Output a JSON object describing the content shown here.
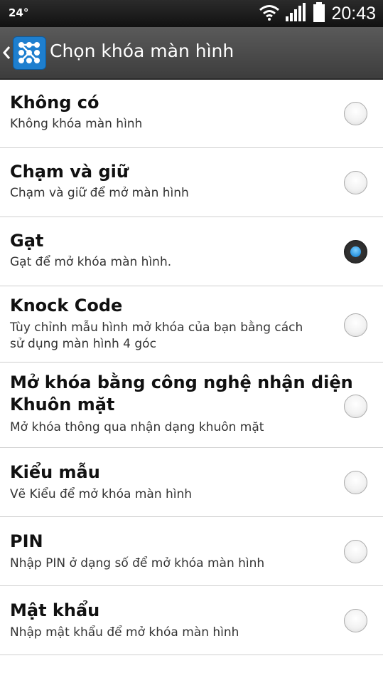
{
  "status_bar": {
    "temperature": "24°",
    "time": "20:43"
  },
  "header": {
    "back_icon": "chevron-left-icon",
    "app_icon": "pattern-lock-icon",
    "title": "Chọn khóa màn hình"
  },
  "colors": {
    "accent": "#2b95e0",
    "header_bg": "#484848",
    "status_bg": "#1a1a1a"
  },
  "options": [
    {
      "title": "Không có",
      "subtitle": "Không khóa màn hình",
      "selected": false
    },
    {
      "title": "Chạm và giữ",
      "subtitle": "Chạm và giữ để mở màn hình",
      "selected": false
    },
    {
      "title": "Gạt",
      "subtitle": "Gạt để mở khóa màn hình.",
      "selected": true
    },
    {
      "title": "Knock Code",
      "subtitle_lines": [
        "Tùy chỉnh mẫu hình mở khóa của bạn bằng cách",
        "sử dụng màn hình 4 góc"
      ],
      "selected": false
    },
    {
      "title_lines": [
        "Mở khóa bằng công nghệ nhận diện",
        "Khuôn mặt"
      ],
      "subtitle": "Mở khóa thông qua nhận dạng khuôn mặt",
      "selected": false
    },
    {
      "title": "Kiểu mẫu",
      "subtitle": "Vẽ Kiểu để mở khóa màn hình",
      "selected": false
    },
    {
      "title": "PIN",
      "subtitle": "Nhập PIN ở dạng số để mở khóa màn hình",
      "selected": false
    },
    {
      "title": "Mật khẩu",
      "subtitle": "Nhập mật khẩu để mở khóa màn hình",
      "selected": false
    }
  ]
}
